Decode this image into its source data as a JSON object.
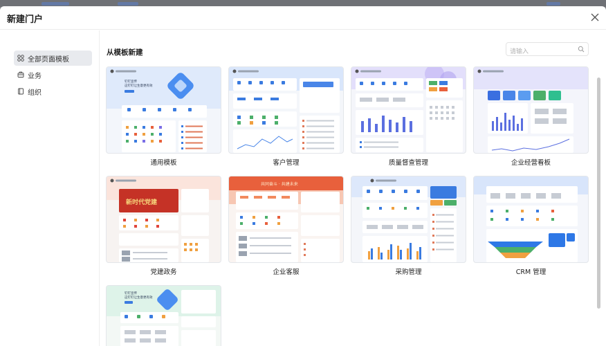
{
  "dialog": {
    "title": "新建门户",
    "close_icon": "close-icon"
  },
  "sidebar": {
    "items": [
      {
        "label": "全部页面模板",
        "icon": "grid-icon",
        "active": true
      },
      {
        "label": "业务",
        "icon": "briefcase-icon",
        "active": false
      },
      {
        "label": "组织",
        "icon": "book-icon",
        "active": false
      }
    ]
  },
  "main": {
    "section_title": "从模板新建",
    "search": {
      "placeholder": "请输入",
      "value": ""
    }
  },
  "templates": [
    {
      "label": "通用模板",
      "theme": "#dbe9fb",
      "accent": "#3a7be0"
    },
    {
      "label": "客户管理",
      "theme": "#dce8fb",
      "accent": "#4a86e8"
    },
    {
      "label": "质量督查管理",
      "theme": "#e4e1fb",
      "accent": "#7b6ee6"
    },
    {
      "label": "企业经营看板",
      "theme": "#e6e6fb",
      "accent": "#5b6fe0"
    },
    {
      "label": "党建政务",
      "theme": "#fbe3dd",
      "accent": "#c9322a"
    },
    {
      "label": "企业客服",
      "theme": "#fbe0d6",
      "accent": "#e8603c"
    },
    {
      "label": "采购管理",
      "theme": "#dfeafb",
      "accent": "#f0a040"
    },
    {
      "label": "CRM 管理",
      "theme": "#dde9fb",
      "accent": "#2e78e6"
    },
    {
      "label": "",
      "theme": "#dff3ea",
      "accent": "#3a7be0"
    }
  ],
  "thumb_texts": {
    "hero": [
      "钉钉宣传",
      "这钉钉让生意更有效"
    ],
    "party_banner": "新时代党建",
    "service_banner": "共同奋斗 · 共建未来"
  }
}
